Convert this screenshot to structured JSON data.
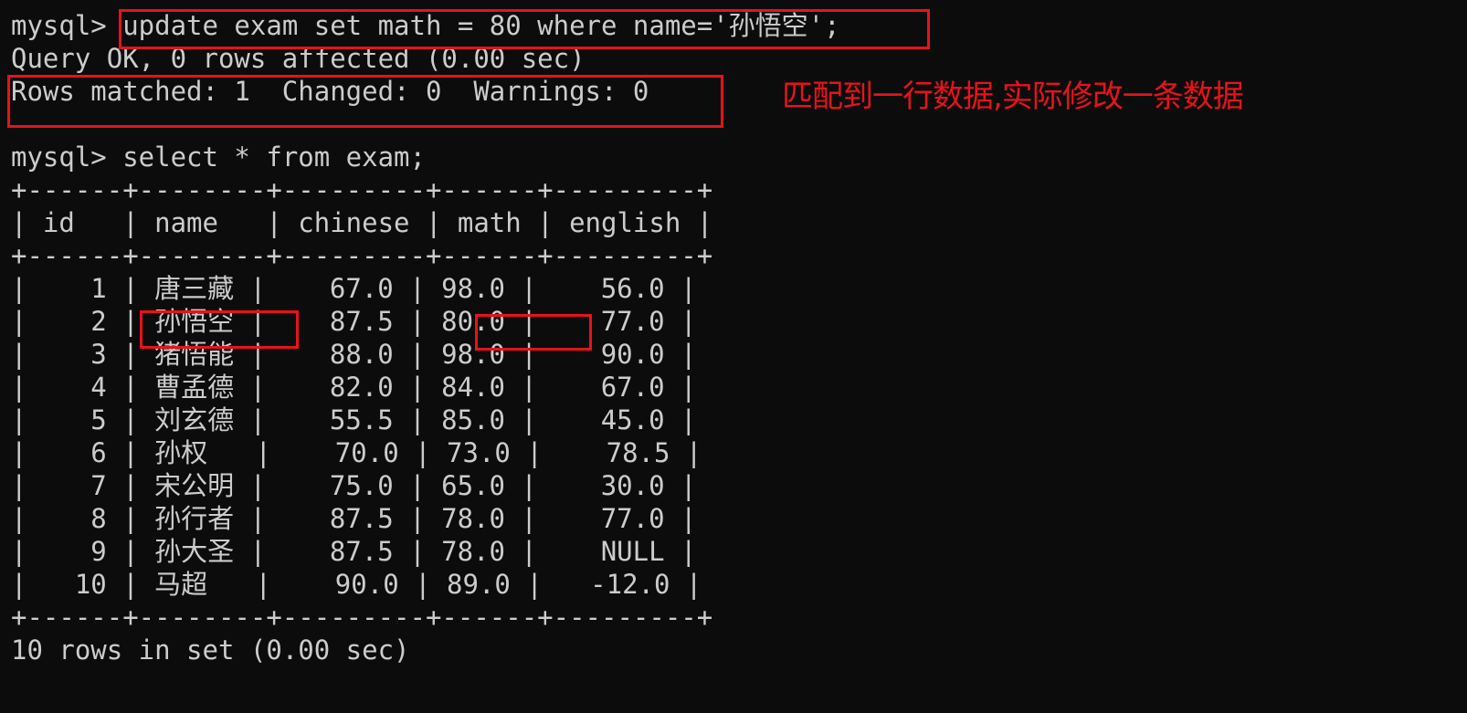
{
  "prompt": "mysql> ",
  "commands": {
    "update": "update exam set math = 80 where name='孙悟空';",
    "select": "select * from exam;"
  },
  "output": {
    "query_ok": "Query OK, 0 rows affected (0.00 sec)",
    "rows_matched": "Rows matched: 1  Changed: 0  Warnings: 0",
    "rows_in_set": "10 rows in set (0.00 sec)"
  },
  "annotation": {
    "note": "匹配到一行数据,实际修改一条数据",
    "color": "#e8121b"
  },
  "table": {
    "border": "+------+--------+---------+------+---------+",
    "header": "| id   | name   | chinese | math | english |",
    "columns": [
      "id",
      "name",
      "chinese",
      "math",
      "english"
    ],
    "rows": [
      "|    1 | 唐三藏 |    67.0 | 98.0 |    56.0 |",
      "|    2 | 孙悟空 |    87.5 | 80.0 |    77.0 |",
      "|    3 | 猪悟能 |    88.0 | 98.0 |    90.0 |",
      "|    4 | 曹孟德 |    82.0 | 84.0 |    67.0 |",
      "|    5 | 刘玄德 |    55.5 | 85.0 |    45.0 |",
      "|    6 | 孙权   |    70.0 | 73.0 |    78.5 |",
      "|    7 | 宋公明 |    75.0 | 65.0 |    30.0 |",
      "|    8 | 孙行者 |    87.5 | 78.0 |    77.0 |",
      "|    9 | 孙大圣 |    87.5 | 78.0 |    NULL |",
      "|   10 | 马超   |    90.0 | 89.0 |   -12.0 |"
    ]
  }
}
